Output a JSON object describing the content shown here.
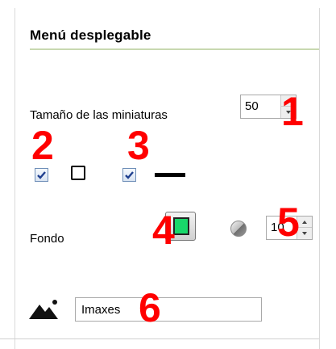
{
  "section": {
    "title": "Menú desplegable"
  },
  "thumbnail_size": {
    "label": "Tamaño de las miniaturas",
    "value": "50"
  },
  "options": {
    "checkbox_square_checked": true,
    "checkbox_line_checked": true
  },
  "background": {
    "label": "Fondo",
    "color": "#18d86a",
    "opacity_value": "10"
  },
  "image_field": {
    "value": "Imaxes"
  },
  "annotations": [
    "1",
    "2",
    "3",
    "4",
    "5",
    "6"
  ],
  "icons": {
    "spinner_up": "triangle-up-icon",
    "spinner_down": "triangle-down-icon",
    "opacity": "opacity-icon",
    "image": "mountain-image-icon"
  }
}
